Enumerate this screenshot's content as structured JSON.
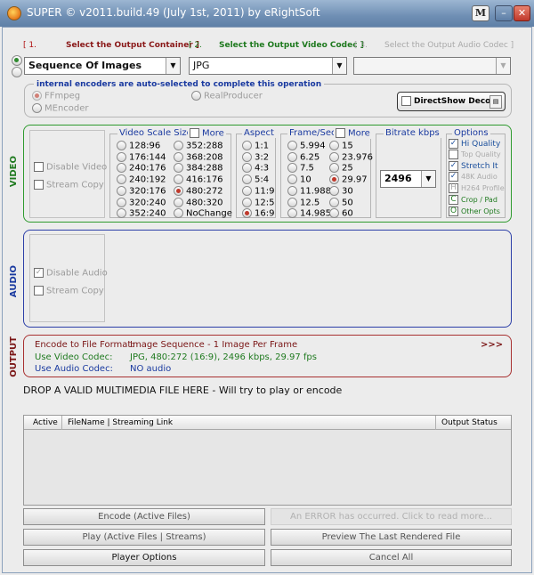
{
  "window": {
    "title": "SUPER © v2011.build.49 (July 1st, 2011) by eRightSoft",
    "m_button": "M",
    "minimize": "–",
    "close": "✕"
  },
  "steps": {
    "s1_num": "[ 1.",
    "s1_text": "Select the Output Container ]",
    "s2_num": "[ 2.",
    "s2_text": "Select the Output Video Codec ]",
    "s3_num": "[ 3.",
    "s3_text": "Select the Output Audio Codec ]"
  },
  "container": {
    "value": "Sequence Of Images"
  },
  "video_codec": {
    "value": "JPG"
  },
  "audio_codec": {
    "value": ""
  },
  "encoders": {
    "title": "internal encoders are auto-selected to complete this operation",
    "ffmpeg": "FFmpeg",
    "mencoder": "MEncoder",
    "realproducer": "RealProducer",
    "directshow": "DirectShow Decode"
  },
  "video": {
    "side": "VIDEO",
    "disable": "Disable Video",
    "stream_copy": "Stream Copy",
    "scale_title": "Video Scale Size",
    "scale_more": "More",
    "scale_col1": [
      "128:96",
      "176:144",
      "240:176",
      "240:192",
      "320:176",
      "320:240",
      "352:240"
    ],
    "scale_col2": [
      "352:288",
      "368:208",
      "384:288",
      "416:176",
      "480:272",
      "480:320",
      "NoChange"
    ],
    "aspect_title": "Aspect",
    "aspect": [
      "1:1",
      "3:2",
      "4:3",
      "5:4",
      "11:9",
      "12:5",
      "16:9"
    ],
    "fps_title": "Frame/Sec",
    "fps_more": "More",
    "fps_col1": [
      "5.994",
      "6.25",
      "7.5",
      "10",
      "11.988",
      "12.5",
      "14.985"
    ],
    "fps_col2": [
      "15",
      "23.976",
      "25",
      "29.97",
      "30",
      "50",
      "60"
    ],
    "bitrate_title": "Bitrate  kbps",
    "bitrate": "2496",
    "options_title": "Options",
    "options": {
      "hi_quality": "Hi Quality",
      "top_quality": "Top Quality",
      "stretch": "Stretch It",
      "audio48k": "48K Audio",
      "h264": "H264 Profile",
      "crop": "Crop / Pad",
      "other": "Other Opts",
      "c": "C",
      "o": "O",
      "h": "H"
    }
  },
  "audio": {
    "side": "AUDIO",
    "disable": "Disable Audio",
    "stream_copy": "Stream Copy"
  },
  "output": {
    "side": "OUTPUT",
    "format_label": "Encode to File Format:",
    "format_value": "Image Sequence - 1 Image Per Frame",
    "video_label": "Use Video Codec:",
    "video_value": "JPG,  480:272 (16:9),  2496 kbps,  29.97 fps",
    "audio_label": "Use Audio Codec:",
    "audio_value": "NO audio",
    "more": ">>>"
  },
  "drop": "DROP A VALID MULTIMEDIA FILE HERE - Will try to play or encode",
  "table": {
    "col_active": "Active",
    "col_filename": "FileName  |  Streaming Link",
    "col_status": "Output Status"
  },
  "buttons": {
    "encode": "Encode (Active Files)",
    "error": "An ERROR has occurred. Click to read more...",
    "play": "Play (Active Files | Streams)",
    "preview": "Preview The Last Rendered File",
    "player_options": "Player Options",
    "cancel": "Cancel All"
  }
}
